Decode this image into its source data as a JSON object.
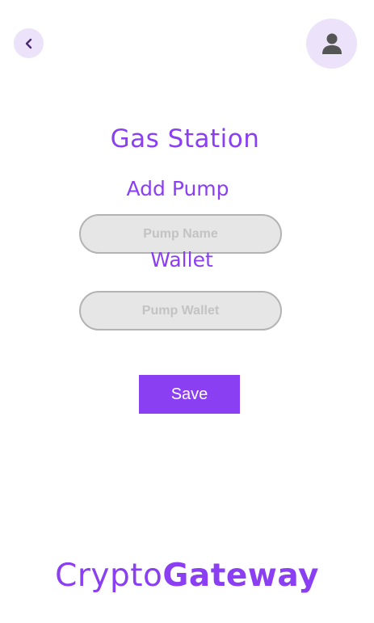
{
  "header": {
    "back_icon": "chevron-left-icon",
    "profile_icon": "user-icon"
  },
  "page": {
    "title": "Gas Station",
    "subtitle": "Add Pump"
  },
  "form": {
    "pump_name": {
      "value": "",
      "placeholder": "Pump Name"
    },
    "wallet_label": "Wallet",
    "pump_wallet": {
      "value": "",
      "placeholder": "Pump Wallet"
    },
    "save_label": "Save"
  },
  "footer": {
    "logo_light": "Crypto",
    "logo_bold": "Gateway"
  },
  "colors": {
    "accent": "#8a3ff2",
    "icon_bg": "#ece2f9",
    "input_bg": "#e6e6e6",
    "input_border": "#b3b3b3",
    "icon_dark": "#555555"
  }
}
